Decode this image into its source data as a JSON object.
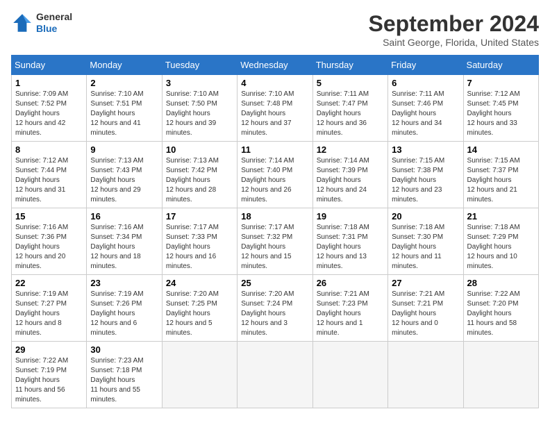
{
  "logo": {
    "general": "General",
    "blue": "Blue"
  },
  "title": "September 2024",
  "location": "Saint George, Florida, United States",
  "days_header": [
    "Sunday",
    "Monday",
    "Tuesday",
    "Wednesday",
    "Thursday",
    "Friday",
    "Saturday"
  ],
  "weeks": [
    [
      {
        "day": "1",
        "sunrise": "7:09 AM",
        "sunset": "7:52 PM",
        "daylight": "12 hours and 42 minutes."
      },
      {
        "day": "2",
        "sunrise": "7:10 AM",
        "sunset": "7:51 PM",
        "daylight": "12 hours and 41 minutes."
      },
      {
        "day": "3",
        "sunrise": "7:10 AM",
        "sunset": "7:50 PM",
        "daylight": "12 hours and 39 minutes."
      },
      {
        "day": "4",
        "sunrise": "7:10 AM",
        "sunset": "7:48 PM",
        "daylight": "12 hours and 37 minutes."
      },
      {
        "day": "5",
        "sunrise": "7:11 AM",
        "sunset": "7:47 PM",
        "daylight": "12 hours and 36 minutes."
      },
      {
        "day": "6",
        "sunrise": "7:11 AM",
        "sunset": "7:46 PM",
        "daylight": "12 hours and 34 minutes."
      },
      {
        "day": "7",
        "sunrise": "7:12 AM",
        "sunset": "7:45 PM",
        "daylight": "12 hours and 33 minutes."
      }
    ],
    [
      {
        "day": "8",
        "sunrise": "7:12 AM",
        "sunset": "7:44 PM",
        "daylight": "12 hours and 31 minutes."
      },
      {
        "day": "9",
        "sunrise": "7:13 AM",
        "sunset": "7:43 PM",
        "daylight": "12 hours and 29 minutes."
      },
      {
        "day": "10",
        "sunrise": "7:13 AM",
        "sunset": "7:42 PM",
        "daylight": "12 hours and 28 minutes."
      },
      {
        "day": "11",
        "sunrise": "7:14 AM",
        "sunset": "7:40 PM",
        "daylight": "12 hours and 26 minutes."
      },
      {
        "day": "12",
        "sunrise": "7:14 AM",
        "sunset": "7:39 PM",
        "daylight": "12 hours and 24 minutes."
      },
      {
        "day": "13",
        "sunrise": "7:15 AM",
        "sunset": "7:38 PM",
        "daylight": "12 hours and 23 minutes."
      },
      {
        "day": "14",
        "sunrise": "7:15 AM",
        "sunset": "7:37 PM",
        "daylight": "12 hours and 21 minutes."
      }
    ],
    [
      {
        "day": "15",
        "sunrise": "7:16 AM",
        "sunset": "7:36 PM",
        "daylight": "12 hours and 20 minutes."
      },
      {
        "day": "16",
        "sunrise": "7:16 AM",
        "sunset": "7:34 PM",
        "daylight": "12 hours and 18 minutes."
      },
      {
        "day": "17",
        "sunrise": "7:17 AM",
        "sunset": "7:33 PM",
        "daylight": "12 hours and 16 minutes."
      },
      {
        "day": "18",
        "sunrise": "7:17 AM",
        "sunset": "7:32 PM",
        "daylight": "12 hours and 15 minutes."
      },
      {
        "day": "19",
        "sunrise": "7:18 AM",
        "sunset": "7:31 PM",
        "daylight": "12 hours and 13 minutes."
      },
      {
        "day": "20",
        "sunrise": "7:18 AM",
        "sunset": "7:30 PM",
        "daylight": "12 hours and 11 minutes."
      },
      {
        "day": "21",
        "sunrise": "7:18 AM",
        "sunset": "7:29 PM",
        "daylight": "12 hours and 10 minutes."
      }
    ],
    [
      {
        "day": "22",
        "sunrise": "7:19 AM",
        "sunset": "7:27 PM",
        "daylight": "12 hours and 8 minutes."
      },
      {
        "day": "23",
        "sunrise": "7:19 AM",
        "sunset": "7:26 PM",
        "daylight": "12 hours and 6 minutes."
      },
      {
        "day": "24",
        "sunrise": "7:20 AM",
        "sunset": "7:25 PM",
        "daylight": "12 hours and 5 minutes."
      },
      {
        "day": "25",
        "sunrise": "7:20 AM",
        "sunset": "7:24 PM",
        "daylight": "12 hours and 3 minutes."
      },
      {
        "day": "26",
        "sunrise": "7:21 AM",
        "sunset": "7:23 PM",
        "daylight": "12 hours and 1 minute."
      },
      {
        "day": "27",
        "sunrise": "7:21 AM",
        "sunset": "7:21 PM",
        "daylight": "12 hours and 0 minutes."
      },
      {
        "day": "28",
        "sunrise": "7:22 AM",
        "sunset": "7:20 PM",
        "daylight": "11 hours and 58 minutes."
      }
    ],
    [
      {
        "day": "29",
        "sunrise": "7:22 AM",
        "sunset": "7:19 PM",
        "daylight": "11 hours and 56 minutes."
      },
      {
        "day": "30",
        "sunrise": "7:23 AM",
        "sunset": "7:18 PM",
        "daylight": "11 hours and 55 minutes."
      },
      null,
      null,
      null,
      null,
      null
    ]
  ],
  "labels": {
    "sunrise": "Sunrise:",
    "sunset": "Sunset:",
    "daylight": "Daylight hours"
  }
}
